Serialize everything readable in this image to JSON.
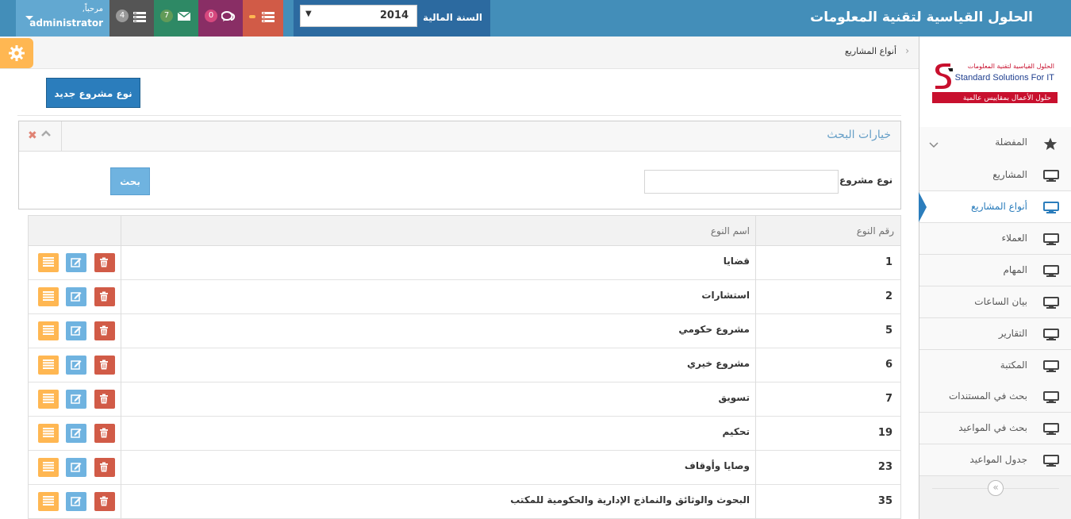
{
  "header": {
    "brand": "الحلول القياسية لتقنية المعلومات",
    "year_label": "السنة المالية",
    "year_value": "2014",
    "badges": {
      "tasks": "4",
      "mail": "7",
      "chat": "0"
    },
    "user": {
      "greeting": "مرحباً,",
      "name": "administrator"
    },
    "colors": {
      "bar": "#438eb9",
      "year_box": "#2c6aa0",
      "tasks": "#555555",
      "mail": "#2e8965",
      "chat": "#892e65",
      "alerts": "#d15b47"
    }
  },
  "logo": {
    "arabic_top": "الحلول القياسية لتقنية المعلومات",
    "english": "Standard Solutions For IT",
    "tagline": "حلول الأعمال بمقاييس عالمية"
  },
  "sidebar": {
    "items": [
      {
        "label": "المفضلة",
        "icon": "star-icon"
      },
      {
        "label": "المشاريع",
        "icon": "monitor-icon"
      },
      {
        "label": "أنواع المشاريع",
        "icon": "monitor-icon",
        "active": true
      },
      {
        "label": "العملاء",
        "icon": "monitor-icon"
      },
      {
        "label": "المهام",
        "icon": "monitor-icon"
      },
      {
        "label": "بيان الساعات",
        "icon": "monitor-icon"
      },
      {
        "label": "التقارير",
        "icon": "monitor-icon"
      },
      {
        "label": "المكتبة",
        "icon": "monitor-icon"
      },
      {
        "label": "بحث في المستندات",
        "icon": "monitor-icon"
      },
      {
        "label": "بحث في المواعيد",
        "icon": "monitor-icon"
      },
      {
        "label": "جدول المواعيد",
        "icon": "monitor-icon"
      }
    ]
  },
  "breadcrumb": "أنواع المشاريع",
  "new_button": "نوع مشروع جديد",
  "search": {
    "title": "خيارات البحث",
    "field_label": "نوع مشروع",
    "field_value": "",
    "button": "بحث"
  },
  "table": {
    "headers": {
      "number": "رقم النوع",
      "name": "اسم النوع"
    },
    "rows": [
      {
        "number": "1",
        "name": "قضايا"
      },
      {
        "number": "2",
        "name": "استشارات"
      },
      {
        "number": "5",
        "name": "مشروع حكومي"
      },
      {
        "number": "6",
        "name": "مشروع خيري"
      },
      {
        "number": "7",
        "name": "تسويق"
      },
      {
        "number": "19",
        "name": "تحكيم"
      },
      {
        "number": "23",
        "name": "وصايا وأوقاف"
      },
      {
        "number": "35",
        "name": "البحوث والوثائق والنماذج الإدارية والحكومية للمكتب"
      }
    ]
  }
}
